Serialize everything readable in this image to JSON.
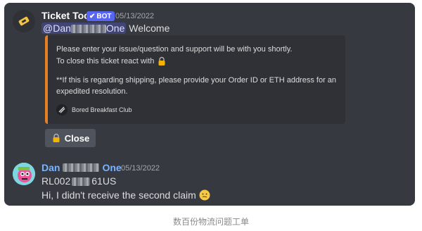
{
  "bot_message": {
    "author": "Ticket Tool",
    "badge": "BOT",
    "timestamp": "05/13/2022",
    "mention_prefix": "@Dan",
    "mention_suffix": "One",
    "greeting": "Welcome",
    "embed": {
      "line1": "Please enter your issue/question and support will be with you shortly.",
      "line2": "To close this ticket react with",
      "line3": "**If this is regarding shipping, please provide your Order ID or ETH address for an",
      "line4": "expedited resolution.",
      "footer": "Bored Breakfast Club",
      "accent_color": "#e67e22"
    },
    "close_button": "Close"
  },
  "user_message": {
    "author_prefix": "Dan",
    "author_suffix": "One",
    "timestamp": "05/13/2022",
    "line1_prefix": "RL002",
    "line1_suffix": "61US",
    "line2": "Hi, I didn't receive the second claim"
  },
  "caption": "数百份物流问题工单"
}
